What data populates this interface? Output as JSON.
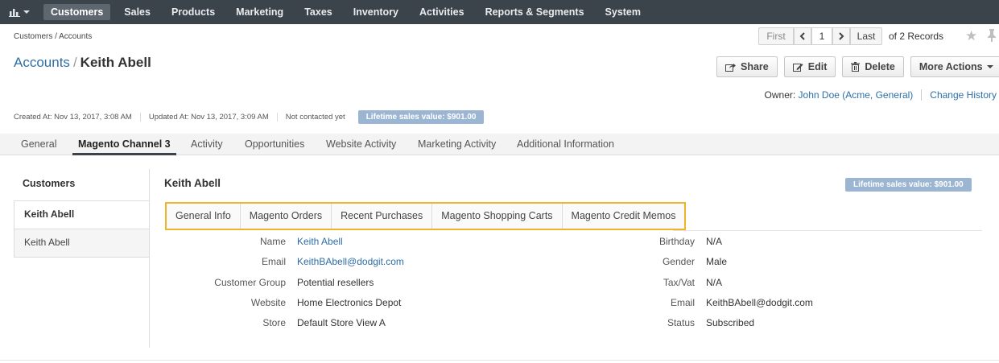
{
  "nav": {
    "items": [
      "Customers",
      "Sales",
      "Products",
      "Marketing",
      "Taxes",
      "Inventory",
      "Activities",
      "Reports & Segments",
      "System"
    ]
  },
  "breadcrumb": "Customers / Accounts",
  "pager": {
    "first": "First",
    "page": "1",
    "last": "Last",
    "of": "of 2 Records"
  },
  "title": {
    "crumb": "Accounts",
    "sep": "/",
    "name": "Keith Abell"
  },
  "actions": {
    "share": "Share",
    "edit": "Edit",
    "delete": "Delete",
    "more": "More Actions"
  },
  "owner": {
    "label": "Owner:",
    "value": "John Doe (Acme, General)",
    "history": "Change History"
  },
  "meta": {
    "created": "Created At: Nov 13, 2017, 3:08 AM",
    "updated": "Updated At: Nov 13, 2017, 3:09 AM",
    "contacted": "Not contacted yet",
    "lifetime": "Lifetime sales value: $901.00"
  },
  "tabs": [
    "General",
    "Magento Channel 3",
    "Activity",
    "Opportunities",
    "Website Activity",
    "Marketing Activity",
    "Additional Information"
  ],
  "leftpanel": {
    "heading": "Customers",
    "items": [
      "Keith Abell",
      "Keith Abell"
    ]
  },
  "main": {
    "name": "Keith Abell",
    "lifetime": "Lifetime sales value: $901.00",
    "subtabs": [
      "General Info",
      "Magento Orders",
      "Recent Purchases",
      "Magento Shopping Carts",
      "Magento Credit Memos"
    ],
    "left_fields": [
      {
        "label": "Name",
        "value": "Keith Abell"
      },
      {
        "label": "Email",
        "value": "KeithBAbell@dodgit.com"
      },
      {
        "label": "Customer Group",
        "value": "Potential resellers"
      },
      {
        "label": "Website",
        "value": "Home Electronics Depot"
      },
      {
        "label": "Store",
        "value": "Default Store View A"
      }
    ],
    "right_fields": [
      {
        "label": "Birthday",
        "value": "N/A"
      },
      {
        "label": "Gender",
        "value": "Male"
      },
      {
        "label": "Tax/Vat",
        "value": "N/A"
      },
      {
        "label": "Email",
        "value": "KeithBAbell@dodgit.com"
      },
      {
        "label": "Status",
        "value": "Subscribed"
      }
    ]
  },
  "colors": {
    "nav_bg": "#3b434b",
    "link": "#2e6ea6",
    "badge": "#9bb5d3",
    "highlight": "#f0b429"
  }
}
